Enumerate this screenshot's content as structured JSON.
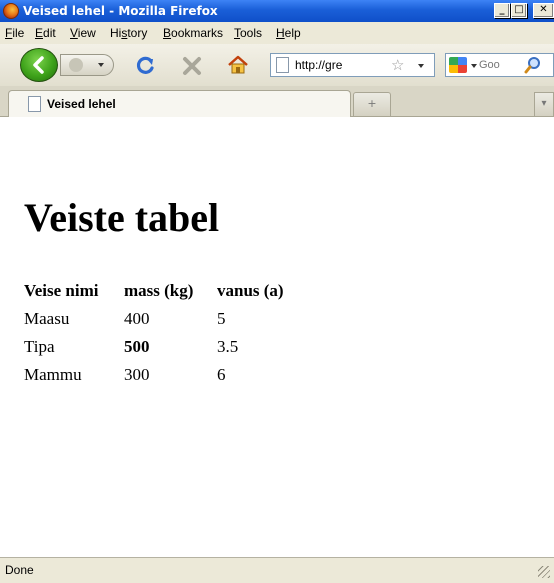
{
  "window": {
    "title": "Veised lehel - Mozilla Firefox"
  },
  "menu": [
    {
      "label": "File",
      "underline": "F",
      "rest": "ile"
    },
    {
      "label": "Edit",
      "underline": "E",
      "rest": "dit"
    },
    {
      "label": "View",
      "underline": "V",
      "rest": "iew"
    },
    {
      "label": "History",
      "pre": "Hi",
      "underline": "s",
      "rest": "tory"
    },
    {
      "label": "Bookmarks",
      "underline": "B",
      "rest": "ookmarks"
    },
    {
      "label": "Tools",
      "underline": "T",
      "rest": "ools"
    },
    {
      "label": "Help",
      "underline": "H",
      "rest": "elp"
    }
  ],
  "toolbar": {
    "url_value": "http://gre",
    "search_value": "Goo",
    "icons": [
      "back-icon",
      "forward-icon",
      "reload-icon",
      "stop-icon",
      "home-icon",
      "bookmark-star-icon",
      "google-icon",
      "search-icon"
    ]
  },
  "tab": {
    "label": "Veised lehel"
  },
  "page": {
    "heading": "Veiste tabel",
    "table": {
      "headers": [
        "Veise nimi",
        "mass (kg)",
        "vanus (a)"
      ],
      "rows": [
        [
          "Maasu",
          "400",
          "5"
        ],
        [
          "Tipa",
          "500",
          "3.5"
        ],
        [
          "Mammu",
          "300",
          "6"
        ]
      ]
    }
  },
  "status": {
    "text": "Done"
  },
  "colors": {
    "titlebar": "#1a5fd8",
    "chrome": "#ece9d8",
    "back_button": "#3ea21a"
  }
}
